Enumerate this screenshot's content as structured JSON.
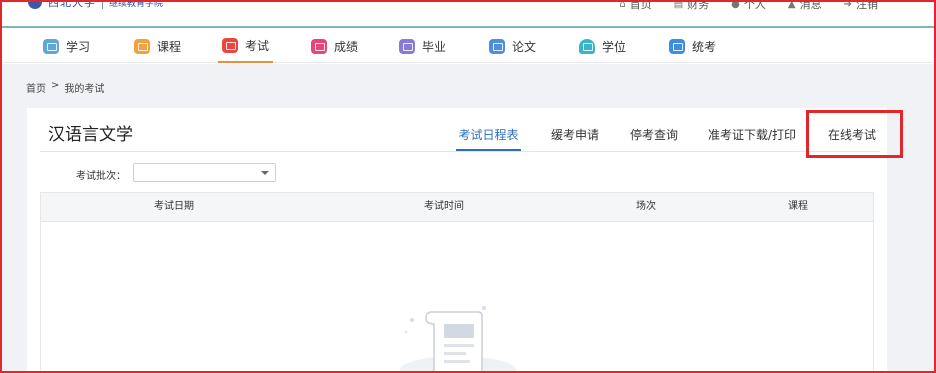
{
  "header": {
    "logo_cn": "西北大学",
    "logo_sub": "继续教育学院",
    "topnav": [
      {
        "label": "首页",
        "icon": "home-icon",
        "glyph": "⌂"
      },
      {
        "label": "财务",
        "icon": "finance-icon",
        "glyph": "▤"
      },
      {
        "label": "个人",
        "icon": "user-icon",
        "glyph": "●"
      },
      {
        "label": "消息",
        "icon": "bell-icon",
        "glyph": "▲"
      },
      {
        "label": "注销",
        "icon": "logout-icon",
        "glyph": "➔"
      }
    ]
  },
  "mainnav": {
    "items": [
      {
        "label": "学习",
        "icon": "study-icon"
      },
      {
        "label": "课程",
        "icon": "course-icon"
      },
      {
        "label": "考试",
        "icon": "exam-icon",
        "active": true
      },
      {
        "label": "成绩",
        "icon": "grade-icon"
      },
      {
        "label": "毕业",
        "icon": "graduation-icon"
      },
      {
        "label": "论文",
        "icon": "thesis-icon"
      },
      {
        "label": "学位",
        "icon": "degree-icon"
      },
      {
        "label": "统考",
        "icon": "unified-exam-icon"
      }
    ]
  },
  "breadcrumb": {
    "home": "首页",
    "sep": ">",
    "current": "我的考试"
  },
  "course": {
    "title": "汉语言文学"
  },
  "tabs": [
    {
      "label": "考试日程表",
      "active": true
    },
    {
      "label": "缓考申请"
    },
    {
      "label": "停考查询"
    },
    {
      "label": "准考证下载/打印"
    },
    {
      "label": "在线考试",
      "highlighted": true
    }
  ],
  "filter": {
    "label": "考试批次：",
    "value": ""
  },
  "table": {
    "columns": [
      "考试日期",
      "考试时间",
      "场次",
      "课程"
    ],
    "rows": []
  },
  "colors": {
    "accent": "#2c6fbf",
    "highlight": "#e3262b",
    "nav_active": "#e8913a",
    "topbar_line": "#7ab9b5"
  }
}
